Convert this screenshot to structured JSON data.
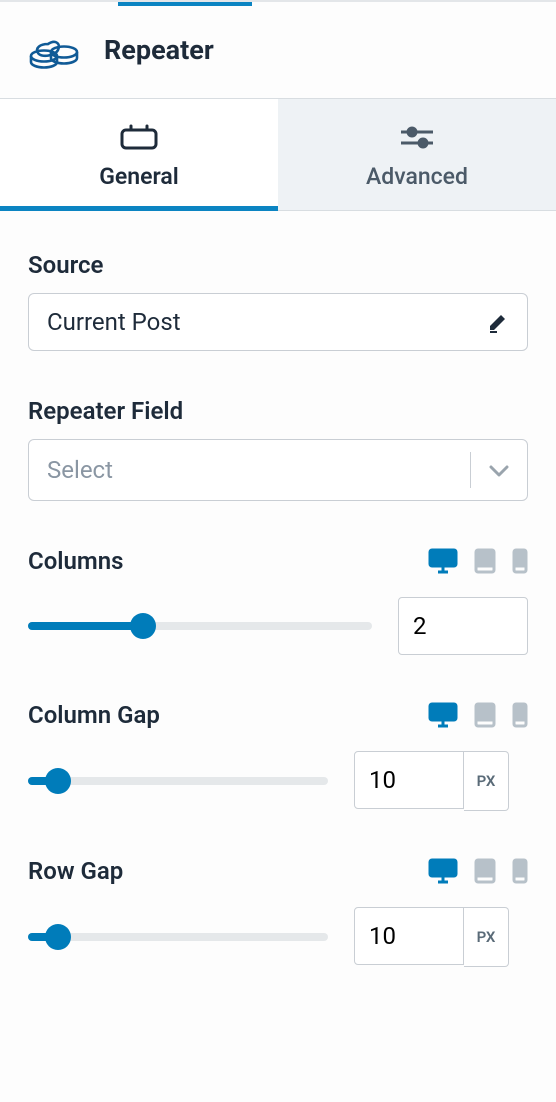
{
  "header": {
    "title": "Repeater",
    "icon": "repeater-icon"
  },
  "tabs": {
    "general": {
      "label": "General",
      "active": true
    },
    "advanced": {
      "label": "Advanced",
      "active": false
    }
  },
  "fields": {
    "source": {
      "label": "Source",
      "value": "Current Post"
    },
    "repeater_field": {
      "label": "Repeater Field",
      "placeholder": "Select"
    },
    "columns": {
      "label": "Columns",
      "value": 2,
      "min": 1,
      "max": 4,
      "device": "desktop"
    },
    "column_gap": {
      "label": "Column Gap",
      "value": 10,
      "unit": "PX",
      "min": 0,
      "max": 100,
      "device": "desktop"
    },
    "row_gap": {
      "label": "Row Gap",
      "value": 10,
      "unit": "PX",
      "min": 0,
      "max": 100,
      "device": "desktop"
    }
  },
  "colors": {
    "brand": "#0073aa",
    "text": "#1e2b3a",
    "muted": "#8a96a3"
  }
}
